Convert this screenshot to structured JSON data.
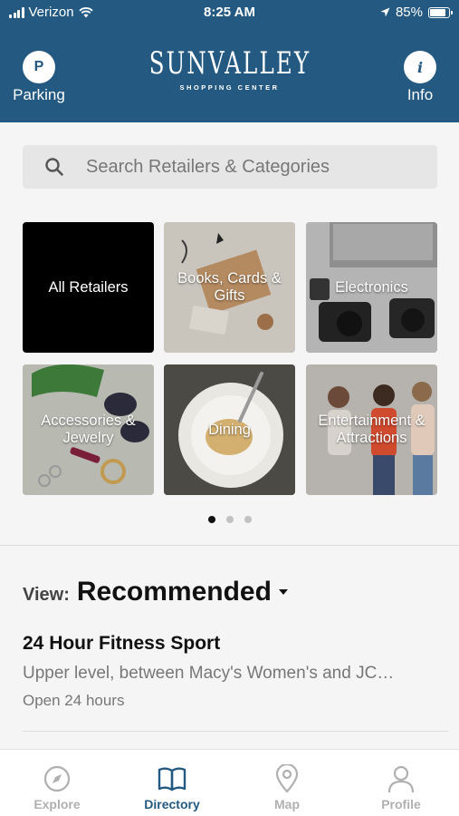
{
  "status_bar": {
    "carrier": "Verizon",
    "time": "8:25 AM",
    "battery": "85%",
    "battery_level": 0.85
  },
  "header": {
    "parking": {
      "icon_letter": "P",
      "label": "Parking"
    },
    "logo": {
      "main": "SUNVALLEY",
      "sub": "SHOPPING CENTER"
    },
    "info": {
      "icon_letter": "i",
      "label": "Info"
    }
  },
  "search": {
    "placeholder": "Search Retailers & Categories"
  },
  "categories": [
    {
      "label": "All Retailers"
    },
    {
      "label": "Books, Cards & Gifts"
    },
    {
      "label": "Electronics"
    },
    {
      "label": "Accessories & Jewelry"
    },
    {
      "label": "Dining"
    },
    {
      "label": "Entertainment & Attractions"
    }
  ],
  "pagination": {
    "pages": 3,
    "active": 1
  },
  "view": {
    "label": "View:",
    "value": "Recommended"
  },
  "listing": {
    "title": "24 Hour Fitness Sport",
    "description": "Upper level, between Macy's Women's and JC…",
    "hours": "Open 24 hours"
  },
  "tabs": [
    {
      "label": "Explore",
      "icon": "compass-icon"
    },
    {
      "label": "Directory",
      "icon": "book-icon"
    },
    {
      "label": "Map",
      "icon": "map-pin-icon"
    },
    {
      "label": "Profile",
      "icon": "person-icon"
    }
  ],
  "colors": {
    "brand": "#245a82",
    "inactive_tab": "#b0b0b0"
  }
}
